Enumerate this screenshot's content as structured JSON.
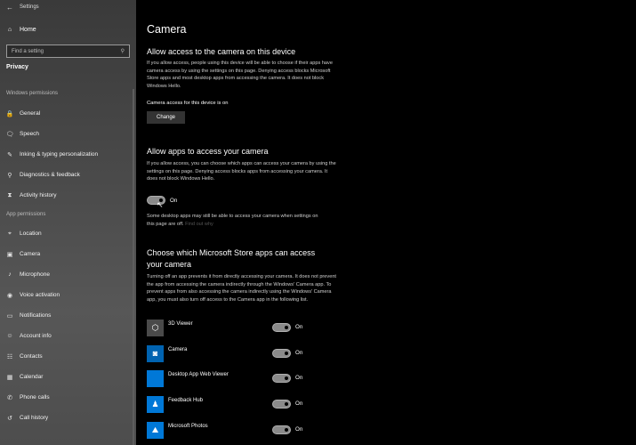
{
  "window": {
    "title": "Settings"
  },
  "sidebar": {
    "home_label": "Home",
    "search_placeholder": "Find a setting",
    "section_title": "Privacy",
    "windows_permissions_title": "Windows permissions",
    "windows_permissions": [
      {
        "label": "General",
        "icon": "lock-icon",
        "glyph": "🔒"
      },
      {
        "label": "Speech",
        "icon": "speech-icon",
        "glyph": "🗨"
      },
      {
        "label": "Inking & typing personalization",
        "icon": "inking-icon",
        "glyph": "✎"
      },
      {
        "label": "Diagnostics & feedback",
        "icon": "diagnostics-icon",
        "glyph": "⚲"
      },
      {
        "label": "Activity history",
        "icon": "activity-history-icon",
        "glyph": "⧗"
      }
    ],
    "app_permissions_title": "App permissions",
    "app_permissions": [
      {
        "label": "Location",
        "icon": "location-icon",
        "glyph": "⌖"
      },
      {
        "label": "Camera",
        "icon": "camera-icon",
        "glyph": "▣"
      },
      {
        "label": "Microphone",
        "icon": "microphone-icon",
        "glyph": "♪"
      },
      {
        "label": "Voice activation",
        "icon": "voice-activation-icon",
        "glyph": "◉"
      },
      {
        "label": "Notifications",
        "icon": "notifications-icon",
        "glyph": "▭"
      },
      {
        "label": "Account info",
        "icon": "account-info-icon",
        "glyph": "☺"
      },
      {
        "label": "Contacts",
        "icon": "contacts-icon",
        "glyph": "☷"
      },
      {
        "label": "Calendar",
        "icon": "calendar-icon",
        "glyph": "▦"
      },
      {
        "label": "Phone calls",
        "icon": "phone-icon",
        "glyph": "✆"
      },
      {
        "label": "Call history",
        "icon": "call-history-icon",
        "glyph": "↺"
      }
    ]
  },
  "main": {
    "page_title": "Camera",
    "device_access": {
      "heading": "Allow access to the camera on this device",
      "description": "If you allow access, people using this device will be able to choose if their apps have camera access by using the settings on this page. Denying access blocks Microsoft Store apps and most desktop apps from accessing the camera. It does not block Windows Hello.",
      "status": "Camera access for this device is on",
      "button_label": "Change"
    },
    "app_access": {
      "heading": "Allow apps to access your camera",
      "description": "If you allow access, you can choose which apps can access your camera by using the settings on this page. Denying access blocks apps from accessing your camera. It does not block Windows Hello.",
      "toggle_state": "On",
      "note": "Some desktop apps may still be able to access your camera when settings on this page are off.",
      "link": "Find out why"
    },
    "store_apps": {
      "heading_line1": "Choose which Microsoft Store apps can access",
      "heading_line2": "your camera",
      "description": "Turning off an app prevents it from directly accessing your camera. It does not prevent the app from accessing the camera indirectly through the Windows' Camera app. To prevent apps from also accessing the camera indirectly using the Windows' Camera app, you must also turn off access to the Camera app in the following list.",
      "apps": [
        {
          "name": "3D Viewer",
          "state": "On",
          "icon": "3d-viewer-icon",
          "glyph": "⬡",
          "color": "#4a4a4a"
        },
        {
          "name": "Camera",
          "state": "On",
          "icon": "camera-app-icon",
          "glyph": "◙",
          "color": "#0063b1"
        },
        {
          "name": "Desktop App Web Viewer",
          "state": "On",
          "icon": "web-viewer-icon",
          "glyph": "",
          "color": "#0078d7"
        },
        {
          "name": "Feedback Hub",
          "state": "On",
          "icon": "feedback-hub-icon",
          "glyph": "♟",
          "color": "#0078d7"
        },
        {
          "name": "Microsoft Photos",
          "state": "On",
          "icon": "photos-icon",
          "glyph": "⛰",
          "color": "#0078d7"
        }
      ]
    }
  }
}
